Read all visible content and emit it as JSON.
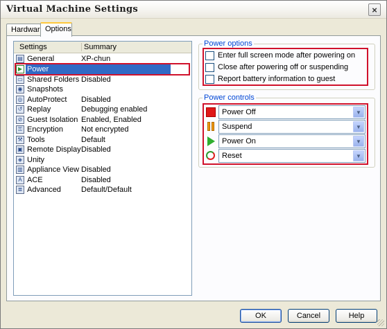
{
  "window": {
    "title": "Virtual Machine Settings",
    "close_glyph": "×"
  },
  "tabs": [
    {
      "label": "Hardware"
    },
    {
      "label": "Options"
    }
  ],
  "list": {
    "headers": {
      "settings": "Settings",
      "summary": "Summary"
    },
    "items": [
      {
        "label": "General",
        "summary": "XP-chun",
        "icon": "general-icon"
      },
      {
        "label": "Power",
        "summary": "",
        "icon": "power-icon"
      },
      {
        "label": "Shared Folders",
        "summary": "Disabled",
        "icon": "folder-icon"
      },
      {
        "label": "Snapshots",
        "summary": "",
        "icon": "snapshot-icon"
      },
      {
        "label": "AutoProtect",
        "summary": "Disabled",
        "icon": "autoprotect-icon"
      },
      {
        "label": "Replay",
        "summary": "Debugging enabled",
        "icon": "replay-icon"
      },
      {
        "label": "Guest Isolation",
        "summary": "Enabled, Enabled",
        "icon": "isolation-icon"
      },
      {
        "label": "Encryption",
        "summary": "Not encrypted",
        "icon": "encryption-icon"
      },
      {
        "label": "Tools",
        "summary": "Default",
        "icon": "tools-icon"
      },
      {
        "label": "Remote Display",
        "summary": "Disabled",
        "icon": "display-icon"
      },
      {
        "label": "Unity",
        "summary": "",
        "icon": "unity-icon"
      },
      {
        "label": "Appliance View",
        "summary": "Disabled",
        "icon": "appliance-icon"
      },
      {
        "label": "ACE",
        "summary": "Disabled",
        "icon": "ace-icon"
      },
      {
        "label": "Advanced",
        "summary": "Default/Default",
        "icon": "advanced-icon"
      }
    ]
  },
  "power_options": {
    "title": "Power options",
    "items": [
      {
        "label": "Enter full screen mode after powering on",
        "checked": false
      },
      {
        "label": "Close after powering off or suspending",
        "checked": false
      },
      {
        "label": "Report battery information to guest",
        "checked": false
      }
    ]
  },
  "power_controls": {
    "title": "Power controls",
    "items": [
      {
        "value": "Power Off",
        "icon": "stop-icon"
      },
      {
        "value": "Suspend",
        "icon": "pause-icon"
      },
      {
        "value": "Power On",
        "icon": "play-icon"
      },
      {
        "value": "Reset",
        "icon": "reset-icon"
      }
    ]
  },
  "buttons": {
    "ok": "OK",
    "cancel": "Cancel",
    "help": "Help"
  },
  "colors": {
    "selection": "#316ac5",
    "highlight_outline": "#d0112b",
    "group_title": "#0046d5"
  }
}
